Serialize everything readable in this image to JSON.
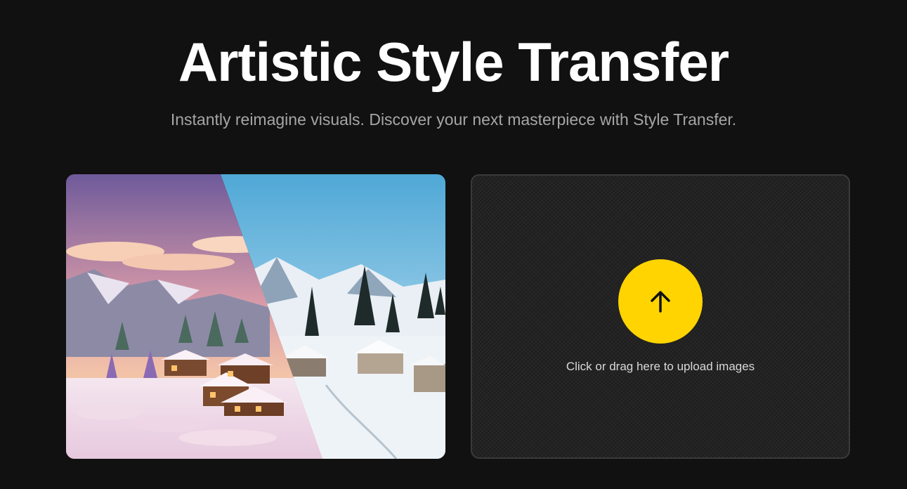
{
  "hero": {
    "title": "Artistic Style Transfer",
    "subtitle": "Instantly reimagine visuals. Discover your next masterpiece with Style Transfer."
  },
  "preview": {
    "icon": "before-after-winter-village-image"
  },
  "upload": {
    "icon": "arrow-up-icon",
    "hint": "Click or drag here to upload images",
    "accent_color": "#ffd400"
  }
}
